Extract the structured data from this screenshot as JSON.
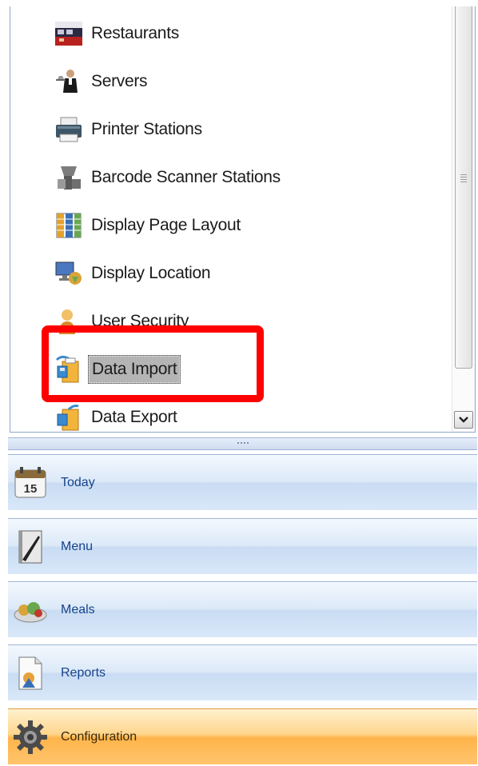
{
  "list": {
    "items": [
      {
        "label": "Restaurants",
        "icon": "restaurant-icon"
      },
      {
        "label": "Servers",
        "icon": "waiter-icon"
      },
      {
        "label": "Printer Stations",
        "icon": "printer-icon"
      },
      {
        "label": "Barcode Scanner Stations",
        "icon": "barcode-scanner-icon"
      },
      {
        "label": "Display Page Layout",
        "icon": "grid-layout-icon"
      },
      {
        "label": "Display Location",
        "icon": "display-location-icon"
      },
      {
        "label": "User Security",
        "icon": "user-security-icon"
      },
      {
        "label": "Data Import",
        "icon": "data-import-icon",
        "selected": true
      },
      {
        "label": "Data Export",
        "icon": "data-export-icon"
      }
    ]
  },
  "nav": {
    "items": [
      {
        "label": "Today",
        "icon": "calendar-icon",
        "calendar_day": "15"
      },
      {
        "label": "Menu",
        "icon": "menu-book-icon"
      },
      {
        "label": "Meals",
        "icon": "meals-icon"
      },
      {
        "label": "Reports",
        "icon": "reports-icon"
      },
      {
        "label": "Configuration",
        "icon": "gear-icon",
        "active": true
      }
    ]
  },
  "colors": {
    "highlight_border": "#ff0000",
    "nav_active": "#ffb44a",
    "nav_inactive": "#dce9f8",
    "nav_text": "#15428b"
  }
}
